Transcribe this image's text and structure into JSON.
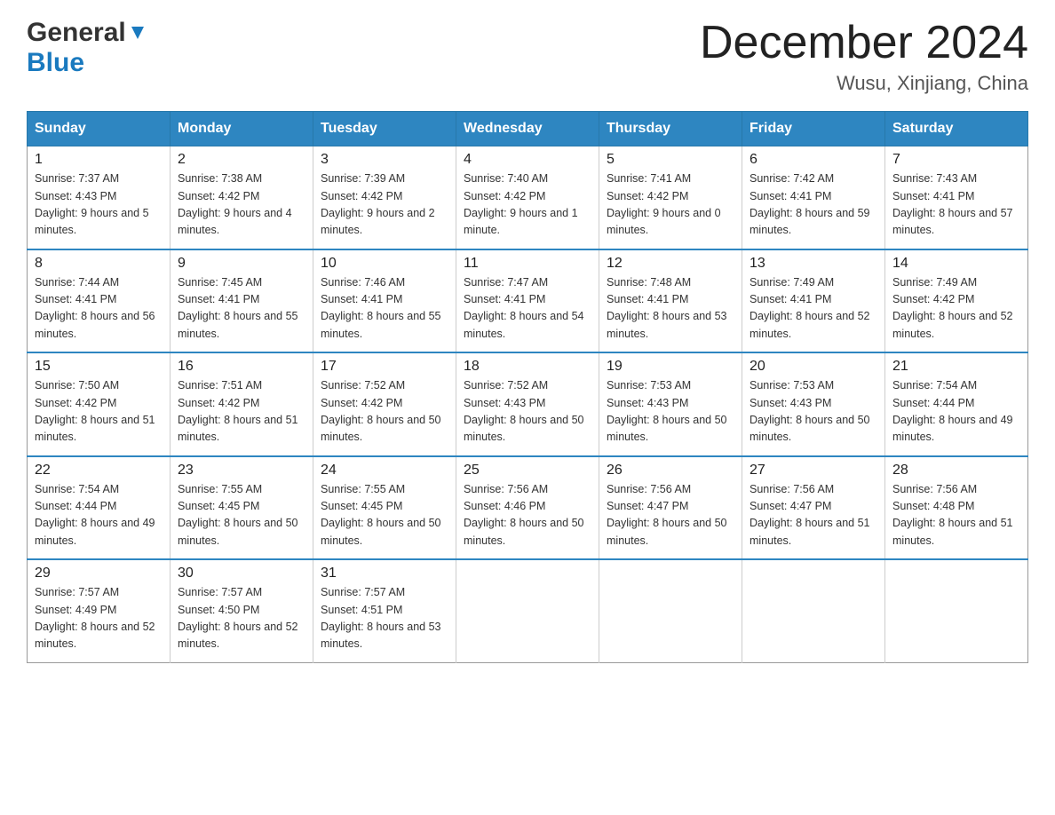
{
  "header": {
    "logo_general": "General",
    "logo_blue": "Blue",
    "title": "December 2024",
    "location": "Wusu, Xinjiang, China"
  },
  "days_of_week": [
    "Sunday",
    "Monday",
    "Tuesday",
    "Wednesday",
    "Thursday",
    "Friday",
    "Saturday"
  ],
  "weeks": [
    [
      {
        "day": "1",
        "sunrise": "7:37 AM",
        "sunset": "4:43 PM",
        "daylight": "9 hours and 5 minutes."
      },
      {
        "day": "2",
        "sunrise": "7:38 AM",
        "sunset": "4:42 PM",
        "daylight": "9 hours and 4 minutes."
      },
      {
        "day": "3",
        "sunrise": "7:39 AM",
        "sunset": "4:42 PM",
        "daylight": "9 hours and 2 minutes."
      },
      {
        "day": "4",
        "sunrise": "7:40 AM",
        "sunset": "4:42 PM",
        "daylight": "9 hours and 1 minute."
      },
      {
        "day": "5",
        "sunrise": "7:41 AM",
        "sunset": "4:42 PM",
        "daylight": "9 hours and 0 minutes."
      },
      {
        "day": "6",
        "sunrise": "7:42 AM",
        "sunset": "4:41 PM",
        "daylight": "8 hours and 59 minutes."
      },
      {
        "day": "7",
        "sunrise": "7:43 AM",
        "sunset": "4:41 PM",
        "daylight": "8 hours and 57 minutes."
      }
    ],
    [
      {
        "day": "8",
        "sunrise": "7:44 AM",
        "sunset": "4:41 PM",
        "daylight": "8 hours and 56 minutes."
      },
      {
        "day": "9",
        "sunrise": "7:45 AM",
        "sunset": "4:41 PM",
        "daylight": "8 hours and 55 minutes."
      },
      {
        "day": "10",
        "sunrise": "7:46 AM",
        "sunset": "4:41 PM",
        "daylight": "8 hours and 55 minutes."
      },
      {
        "day": "11",
        "sunrise": "7:47 AM",
        "sunset": "4:41 PM",
        "daylight": "8 hours and 54 minutes."
      },
      {
        "day": "12",
        "sunrise": "7:48 AM",
        "sunset": "4:41 PM",
        "daylight": "8 hours and 53 minutes."
      },
      {
        "day": "13",
        "sunrise": "7:49 AM",
        "sunset": "4:41 PM",
        "daylight": "8 hours and 52 minutes."
      },
      {
        "day": "14",
        "sunrise": "7:49 AM",
        "sunset": "4:42 PM",
        "daylight": "8 hours and 52 minutes."
      }
    ],
    [
      {
        "day": "15",
        "sunrise": "7:50 AM",
        "sunset": "4:42 PM",
        "daylight": "8 hours and 51 minutes."
      },
      {
        "day": "16",
        "sunrise": "7:51 AM",
        "sunset": "4:42 PM",
        "daylight": "8 hours and 51 minutes."
      },
      {
        "day": "17",
        "sunrise": "7:52 AM",
        "sunset": "4:42 PM",
        "daylight": "8 hours and 50 minutes."
      },
      {
        "day": "18",
        "sunrise": "7:52 AM",
        "sunset": "4:43 PM",
        "daylight": "8 hours and 50 minutes."
      },
      {
        "day": "19",
        "sunrise": "7:53 AM",
        "sunset": "4:43 PM",
        "daylight": "8 hours and 50 minutes."
      },
      {
        "day": "20",
        "sunrise": "7:53 AM",
        "sunset": "4:43 PM",
        "daylight": "8 hours and 50 minutes."
      },
      {
        "day": "21",
        "sunrise": "7:54 AM",
        "sunset": "4:44 PM",
        "daylight": "8 hours and 49 minutes."
      }
    ],
    [
      {
        "day": "22",
        "sunrise": "7:54 AM",
        "sunset": "4:44 PM",
        "daylight": "8 hours and 49 minutes."
      },
      {
        "day": "23",
        "sunrise": "7:55 AM",
        "sunset": "4:45 PM",
        "daylight": "8 hours and 50 minutes."
      },
      {
        "day": "24",
        "sunrise": "7:55 AM",
        "sunset": "4:45 PM",
        "daylight": "8 hours and 50 minutes."
      },
      {
        "day": "25",
        "sunrise": "7:56 AM",
        "sunset": "4:46 PM",
        "daylight": "8 hours and 50 minutes."
      },
      {
        "day": "26",
        "sunrise": "7:56 AM",
        "sunset": "4:47 PM",
        "daylight": "8 hours and 50 minutes."
      },
      {
        "day": "27",
        "sunrise": "7:56 AM",
        "sunset": "4:47 PM",
        "daylight": "8 hours and 51 minutes."
      },
      {
        "day": "28",
        "sunrise": "7:56 AM",
        "sunset": "4:48 PM",
        "daylight": "8 hours and 51 minutes."
      }
    ],
    [
      {
        "day": "29",
        "sunrise": "7:57 AM",
        "sunset": "4:49 PM",
        "daylight": "8 hours and 52 minutes."
      },
      {
        "day": "30",
        "sunrise": "7:57 AM",
        "sunset": "4:50 PM",
        "daylight": "8 hours and 52 minutes."
      },
      {
        "day": "31",
        "sunrise": "7:57 AM",
        "sunset": "4:51 PM",
        "daylight": "8 hours and 53 minutes."
      },
      null,
      null,
      null,
      null
    ]
  ],
  "labels": {
    "sunrise": "Sunrise:",
    "sunset": "Sunset:",
    "daylight": "Daylight:"
  }
}
